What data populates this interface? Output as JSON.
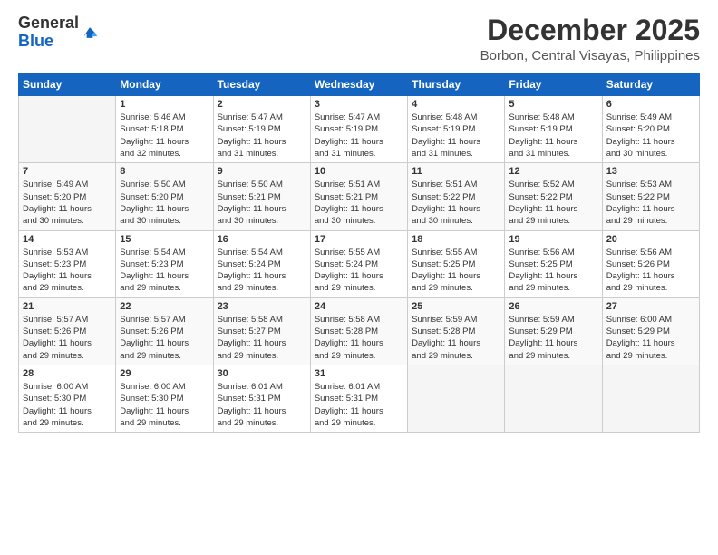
{
  "logo": {
    "line1": "General",
    "line2": "Blue"
  },
  "title": "December 2025",
  "location": "Borbon, Central Visayas, Philippines",
  "days_header": [
    "Sunday",
    "Monday",
    "Tuesday",
    "Wednesday",
    "Thursday",
    "Friday",
    "Saturday"
  ],
  "weeks": [
    [
      {
        "day": "",
        "info": ""
      },
      {
        "day": "1",
        "info": "Sunrise: 5:46 AM\nSunset: 5:18 PM\nDaylight: 11 hours\nand 32 minutes."
      },
      {
        "day": "2",
        "info": "Sunrise: 5:47 AM\nSunset: 5:19 PM\nDaylight: 11 hours\nand 31 minutes."
      },
      {
        "day": "3",
        "info": "Sunrise: 5:47 AM\nSunset: 5:19 PM\nDaylight: 11 hours\nand 31 minutes."
      },
      {
        "day": "4",
        "info": "Sunrise: 5:48 AM\nSunset: 5:19 PM\nDaylight: 11 hours\nand 31 minutes."
      },
      {
        "day": "5",
        "info": "Sunrise: 5:48 AM\nSunset: 5:19 PM\nDaylight: 11 hours\nand 31 minutes."
      },
      {
        "day": "6",
        "info": "Sunrise: 5:49 AM\nSunset: 5:20 PM\nDaylight: 11 hours\nand 30 minutes."
      }
    ],
    [
      {
        "day": "7",
        "info": "Sunrise: 5:49 AM\nSunset: 5:20 PM\nDaylight: 11 hours\nand 30 minutes."
      },
      {
        "day": "8",
        "info": "Sunrise: 5:50 AM\nSunset: 5:20 PM\nDaylight: 11 hours\nand 30 minutes."
      },
      {
        "day": "9",
        "info": "Sunrise: 5:50 AM\nSunset: 5:21 PM\nDaylight: 11 hours\nand 30 minutes."
      },
      {
        "day": "10",
        "info": "Sunrise: 5:51 AM\nSunset: 5:21 PM\nDaylight: 11 hours\nand 30 minutes."
      },
      {
        "day": "11",
        "info": "Sunrise: 5:51 AM\nSunset: 5:22 PM\nDaylight: 11 hours\nand 30 minutes."
      },
      {
        "day": "12",
        "info": "Sunrise: 5:52 AM\nSunset: 5:22 PM\nDaylight: 11 hours\nand 29 minutes."
      },
      {
        "day": "13",
        "info": "Sunrise: 5:53 AM\nSunset: 5:22 PM\nDaylight: 11 hours\nand 29 minutes."
      }
    ],
    [
      {
        "day": "14",
        "info": "Sunrise: 5:53 AM\nSunset: 5:23 PM\nDaylight: 11 hours\nand 29 minutes."
      },
      {
        "day": "15",
        "info": "Sunrise: 5:54 AM\nSunset: 5:23 PM\nDaylight: 11 hours\nand 29 minutes."
      },
      {
        "day": "16",
        "info": "Sunrise: 5:54 AM\nSunset: 5:24 PM\nDaylight: 11 hours\nand 29 minutes."
      },
      {
        "day": "17",
        "info": "Sunrise: 5:55 AM\nSunset: 5:24 PM\nDaylight: 11 hours\nand 29 minutes."
      },
      {
        "day": "18",
        "info": "Sunrise: 5:55 AM\nSunset: 5:25 PM\nDaylight: 11 hours\nand 29 minutes."
      },
      {
        "day": "19",
        "info": "Sunrise: 5:56 AM\nSunset: 5:25 PM\nDaylight: 11 hours\nand 29 minutes."
      },
      {
        "day": "20",
        "info": "Sunrise: 5:56 AM\nSunset: 5:26 PM\nDaylight: 11 hours\nand 29 minutes."
      }
    ],
    [
      {
        "day": "21",
        "info": "Sunrise: 5:57 AM\nSunset: 5:26 PM\nDaylight: 11 hours\nand 29 minutes."
      },
      {
        "day": "22",
        "info": "Sunrise: 5:57 AM\nSunset: 5:26 PM\nDaylight: 11 hours\nand 29 minutes."
      },
      {
        "day": "23",
        "info": "Sunrise: 5:58 AM\nSunset: 5:27 PM\nDaylight: 11 hours\nand 29 minutes."
      },
      {
        "day": "24",
        "info": "Sunrise: 5:58 AM\nSunset: 5:28 PM\nDaylight: 11 hours\nand 29 minutes."
      },
      {
        "day": "25",
        "info": "Sunrise: 5:59 AM\nSunset: 5:28 PM\nDaylight: 11 hours\nand 29 minutes."
      },
      {
        "day": "26",
        "info": "Sunrise: 5:59 AM\nSunset: 5:29 PM\nDaylight: 11 hours\nand 29 minutes."
      },
      {
        "day": "27",
        "info": "Sunrise: 6:00 AM\nSunset: 5:29 PM\nDaylight: 11 hours\nand 29 minutes."
      }
    ],
    [
      {
        "day": "28",
        "info": "Sunrise: 6:00 AM\nSunset: 5:30 PM\nDaylight: 11 hours\nand 29 minutes."
      },
      {
        "day": "29",
        "info": "Sunrise: 6:00 AM\nSunset: 5:30 PM\nDaylight: 11 hours\nand 29 minutes."
      },
      {
        "day": "30",
        "info": "Sunrise: 6:01 AM\nSunset: 5:31 PM\nDaylight: 11 hours\nand 29 minutes."
      },
      {
        "day": "31",
        "info": "Sunrise: 6:01 AM\nSunset: 5:31 PM\nDaylight: 11 hours\nand 29 minutes."
      },
      {
        "day": "",
        "info": ""
      },
      {
        "day": "",
        "info": ""
      },
      {
        "day": "",
        "info": ""
      }
    ]
  ]
}
